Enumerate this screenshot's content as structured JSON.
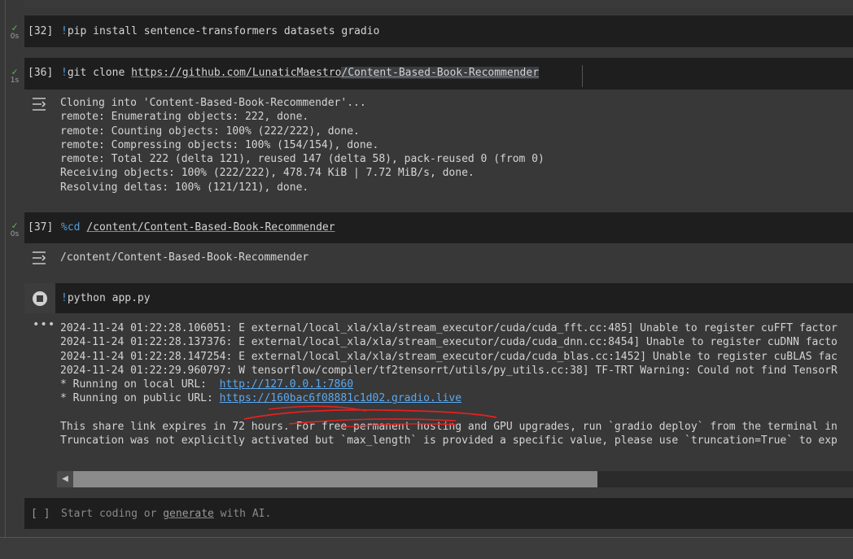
{
  "cells": [
    {
      "id": "c32",
      "count": "[32]",
      "status_time": "0s",
      "bang": "!",
      "code": "pip install sentence-transformers datasets gradio"
    },
    {
      "id": "c36",
      "count": "[36]",
      "status_time": "1s",
      "bang": "!",
      "code_prefix": "git clone ",
      "url_head": "https://github.com/LunaticMaestro",
      "url_tail": "/Content-Based-Book-Recommender",
      "output_lines": [
        "Cloning into 'Content-Based-Book-Recommender'...",
        "remote: Enumerating objects: 222, done.",
        "remote: Counting objects: 100% (222/222), done.",
        "remote: Compressing objects: 100% (154/154), done.",
        "remote: Total 222 (delta 121), reused 147 (delta 58), pack-reused 0 (from 0)",
        "Receiving objects: 100% (222/222), 478.74 KiB | 7.72 MiB/s, done.",
        "Resolving deltas: 100% (121/121), done."
      ]
    },
    {
      "id": "c37",
      "count": "[37]",
      "status_time": "0s",
      "magic": "%cd",
      "path": "/content/Content-Based-Book-Recommender",
      "output_lines": [
        "/content/Content-Based-Book-Recommender"
      ]
    },
    {
      "id": "crun",
      "bang": "!",
      "code": "python app.py",
      "log_lines": [
        "2024-11-24 01:22:28.106051: E external/local_xla/xla/stream_executor/cuda/cuda_fft.cc:485] Unable to register cuFFT factor",
        "2024-11-24 01:22:28.137376: E external/local_xla/xla/stream_executor/cuda/cuda_dnn.cc:8454] Unable to register cuDNN facto",
        "2024-11-24 01:22:28.147254: E external/local_xla/xla/stream_executor/cuda/cuda_blas.cc:1452] Unable to register cuBLAS fac",
        "2024-11-24 01:22:29.960797: W tensorflow/compiler/tf2tensorrt/utils/py_utils.cc:38] TF-TRT Warning: Could not find TensorR"
      ],
      "local_prefix": "* Running on local URL:  ",
      "local_url": "http://127.0.0.1:7860",
      "public_prefix": "* Running on public URL: ",
      "public_url": "https://160bac6f08881c1d02.gradio.live",
      "tail_lines": [
        "This share link expires in 72 hours. For free permanent hosting and GPU upgrades, run `gradio deploy` from the terminal in",
        "Truncation was not explicitly activated but `max_length` is provided a specific value, please use `truncation=True` to exp"
      ]
    }
  ],
  "new_cell": {
    "brackets": "[ ]",
    "prefix": "Start coding or ",
    "link": "generate",
    "suffix": " with AI."
  },
  "colors": {
    "accent": "#5aa9f0",
    "check": "#5fb860",
    "annotation": "#e8201e"
  },
  "icons": {
    "status": "check-icon",
    "output": "output-toggle-icon",
    "stop": "stop-icon",
    "more": "more-icon",
    "scroll_left": "scroll-left-icon"
  }
}
